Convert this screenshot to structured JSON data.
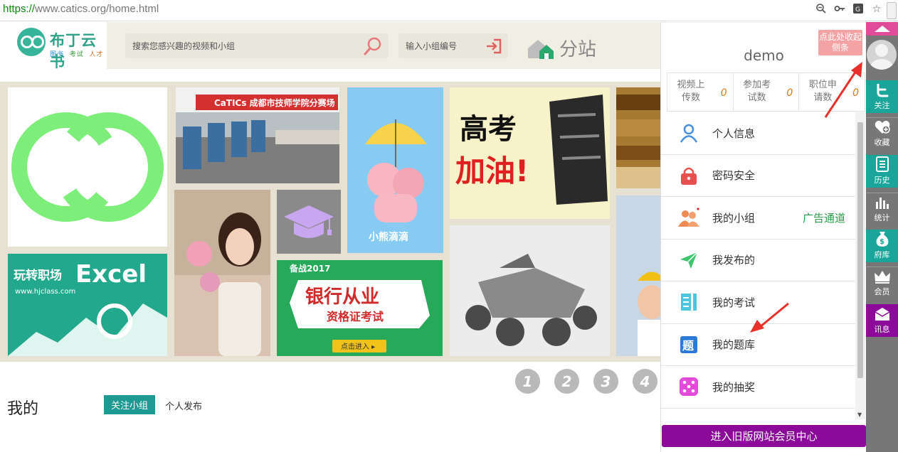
{
  "browser": {
    "url_protocol": "https://",
    "url_rest": "www.catics.org/home.html"
  },
  "header": {
    "logo_title": "布丁云书",
    "logo_tags": [
      "图书",
      "考试",
      "人才"
    ],
    "search_placeholder": "搜索您感兴趣的视频和小组",
    "group_placeholder": "输入小组编号",
    "substation_label": "分站"
  },
  "gallery": {
    "t2_banner": "CaTICs 成都市技师学院分赛场",
    "t3_caption": "小熊滴滴",
    "t4_line1": "高考",
    "t4_line2": "加油!",
    "t8_line1": "玩转职场",
    "t8_line2": "Excel",
    "t8_url": "www.hjclass.com",
    "t9_tag": "备战2017",
    "t9_title": "银行从业",
    "t9_sub": "资格证考试",
    "t9_btn": "点击进入 ▸"
  },
  "pager": [
    "1",
    "2",
    "3",
    "4"
  ],
  "mine": {
    "title": "我的",
    "tab_active": "关注小组",
    "tab_other": "个人发布"
  },
  "panel": {
    "username": "demo",
    "stats": [
      {
        "label": "视频上传数",
        "value": "0"
      },
      {
        "label": "参加考试数",
        "value": "0"
      },
      {
        "label": "职位申请数",
        "value": "0"
      }
    ],
    "menu": [
      {
        "label": "个人信息",
        "icon": "person-icon"
      },
      {
        "label": "密码安全",
        "icon": "lock-icon"
      },
      {
        "label": "我的小组",
        "icon": "group-icon",
        "extra": "广告通道"
      },
      {
        "label": "我发布的",
        "icon": "paper-plane-icon"
      },
      {
        "label": "我的考试",
        "icon": "exam-icon"
      },
      {
        "label": "我的题库",
        "icon": "question-bank-icon"
      },
      {
        "label": "我的抽奖",
        "icon": "dice-icon"
      }
    ],
    "old_center": "进入旧版网站会员中心"
  },
  "sidebar": {
    "tip": "点此处收起侧条",
    "items": [
      {
        "label": "关注",
        "icon": "twitter-icon"
      },
      {
        "label": "收藏",
        "icon": "favorite-icon"
      },
      {
        "label": "历史",
        "icon": "history-icon"
      },
      {
        "label": "统计",
        "icon": "stats-icon"
      },
      {
        "label": "府库",
        "icon": "money-bag-icon"
      },
      {
        "label": "会员",
        "icon": "crown-icon"
      },
      {
        "label": "讯息",
        "icon": "message-icon"
      }
    ]
  },
  "colors": {
    "teal": "#1aa59a",
    "purple": "#8b0a9a",
    "accent_pink": "#e24a9a",
    "orange_value": "#d97b1a"
  }
}
